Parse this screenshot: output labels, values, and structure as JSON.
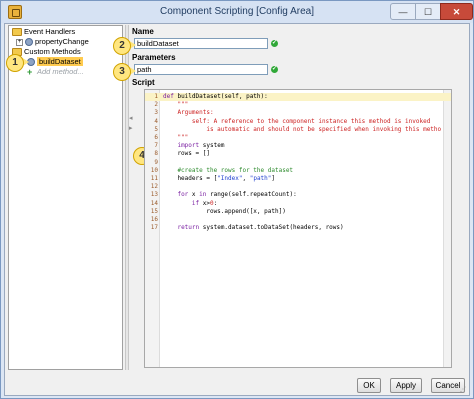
{
  "window": {
    "title": "Component Scripting [Config Area]",
    "min_label": "—",
    "max_label": "☐",
    "close_label": "✕"
  },
  "tree": {
    "items": [
      {
        "label": "Event Handlers",
        "expander": "−"
      },
      {
        "label": "propertyChange",
        "expander": "+"
      },
      {
        "label": "Custom Methods",
        "expander": "−"
      },
      {
        "label": "buildDataset"
      },
      {
        "label": "Add method..."
      }
    ]
  },
  "name_section": {
    "label": "Name",
    "value": "buildDataset"
  },
  "params_section": {
    "label": "Parameters",
    "value": "path"
  },
  "script_section": {
    "label": "Script"
  },
  "callouts": [
    "1",
    "2",
    "3",
    "4"
  ],
  "code_lines": [
    {
      "n": "1",
      "segments": [
        {
          "t": "def ",
          "c": "kw"
        },
        {
          "t": "buildDataset(self, path):",
          "c": "fn"
        }
      ]
    },
    {
      "n": "2",
      "segments": [
        {
          "t": "    \"\"\"",
          "c": "doc"
        }
      ]
    },
    {
      "n": "3",
      "segments": [
        {
          "t": "    Arguments:",
          "c": "doc"
        }
      ]
    },
    {
      "n": "4",
      "segments": [
        {
          "t": "        self: A reference to the component instance this method is invoked",
          "c": "doc"
        }
      ]
    },
    {
      "n": "5",
      "segments": [
        {
          "t": "            is automatic and should not be specified when invoking this metho",
          "c": "doc"
        }
      ]
    },
    {
      "n": "6",
      "segments": [
        {
          "t": "    \"\"\"",
          "c": "doc"
        }
      ]
    },
    {
      "n": "7",
      "segments": [
        {
          "t": "    ",
          "c": "fn"
        },
        {
          "t": "import",
          "c": "kw"
        },
        {
          "t": " system",
          "c": "fn"
        }
      ]
    },
    {
      "n": "8",
      "segments": [
        {
          "t": "    rows = []",
          "c": "fn"
        }
      ]
    },
    {
      "n": "9",
      "segments": []
    },
    {
      "n": "10",
      "segments": [
        {
          "t": "    #create the rows for the dataset",
          "c": "cmt"
        }
      ]
    },
    {
      "n": "11",
      "segments": [
        {
          "t": "    headers = [",
          "c": "fn"
        },
        {
          "t": "\"Index\"",
          "c": "str"
        },
        {
          "t": ", ",
          "c": "fn"
        },
        {
          "t": "\"path\"",
          "c": "str"
        },
        {
          "t": "]",
          "c": "fn"
        }
      ]
    },
    {
      "n": "12",
      "segments": []
    },
    {
      "n": "13",
      "segments": [
        {
          "t": "    ",
          "c": "fn"
        },
        {
          "t": "for",
          "c": "kw"
        },
        {
          "t": " x ",
          "c": "fn"
        },
        {
          "t": "in",
          "c": "kw"
        },
        {
          "t": " range(self.repeatCount):",
          "c": "fn"
        }
      ]
    },
    {
      "n": "14",
      "segments": [
        {
          "t": "        ",
          "c": "fn"
        },
        {
          "t": "if",
          "c": "kw"
        },
        {
          "t": " x>",
          "c": "fn"
        },
        {
          "t": "0",
          "c": "num"
        },
        {
          "t": ":",
          "c": "fn"
        }
      ]
    },
    {
      "n": "15",
      "segments": [
        {
          "t": "            rows.append([x, path])",
          "c": "fn"
        }
      ]
    },
    {
      "n": "16",
      "segments": []
    },
    {
      "n": "17",
      "segments": [
        {
          "t": "    ",
          "c": "fn"
        },
        {
          "t": "return",
          "c": "kw"
        },
        {
          "t": " system.dataset.toDataSet(headers, rows)",
          "c": "fn"
        }
      ]
    }
  ],
  "buttons": {
    "ok": "OK",
    "apply": "Apply",
    "cancel": "Cancel"
  },
  "colors": {
    "selected": "#ffcb4f",
    "callout": "#ffe680",
    "check": "#30a838",
    "close": "#c74a3a"
  }
}
